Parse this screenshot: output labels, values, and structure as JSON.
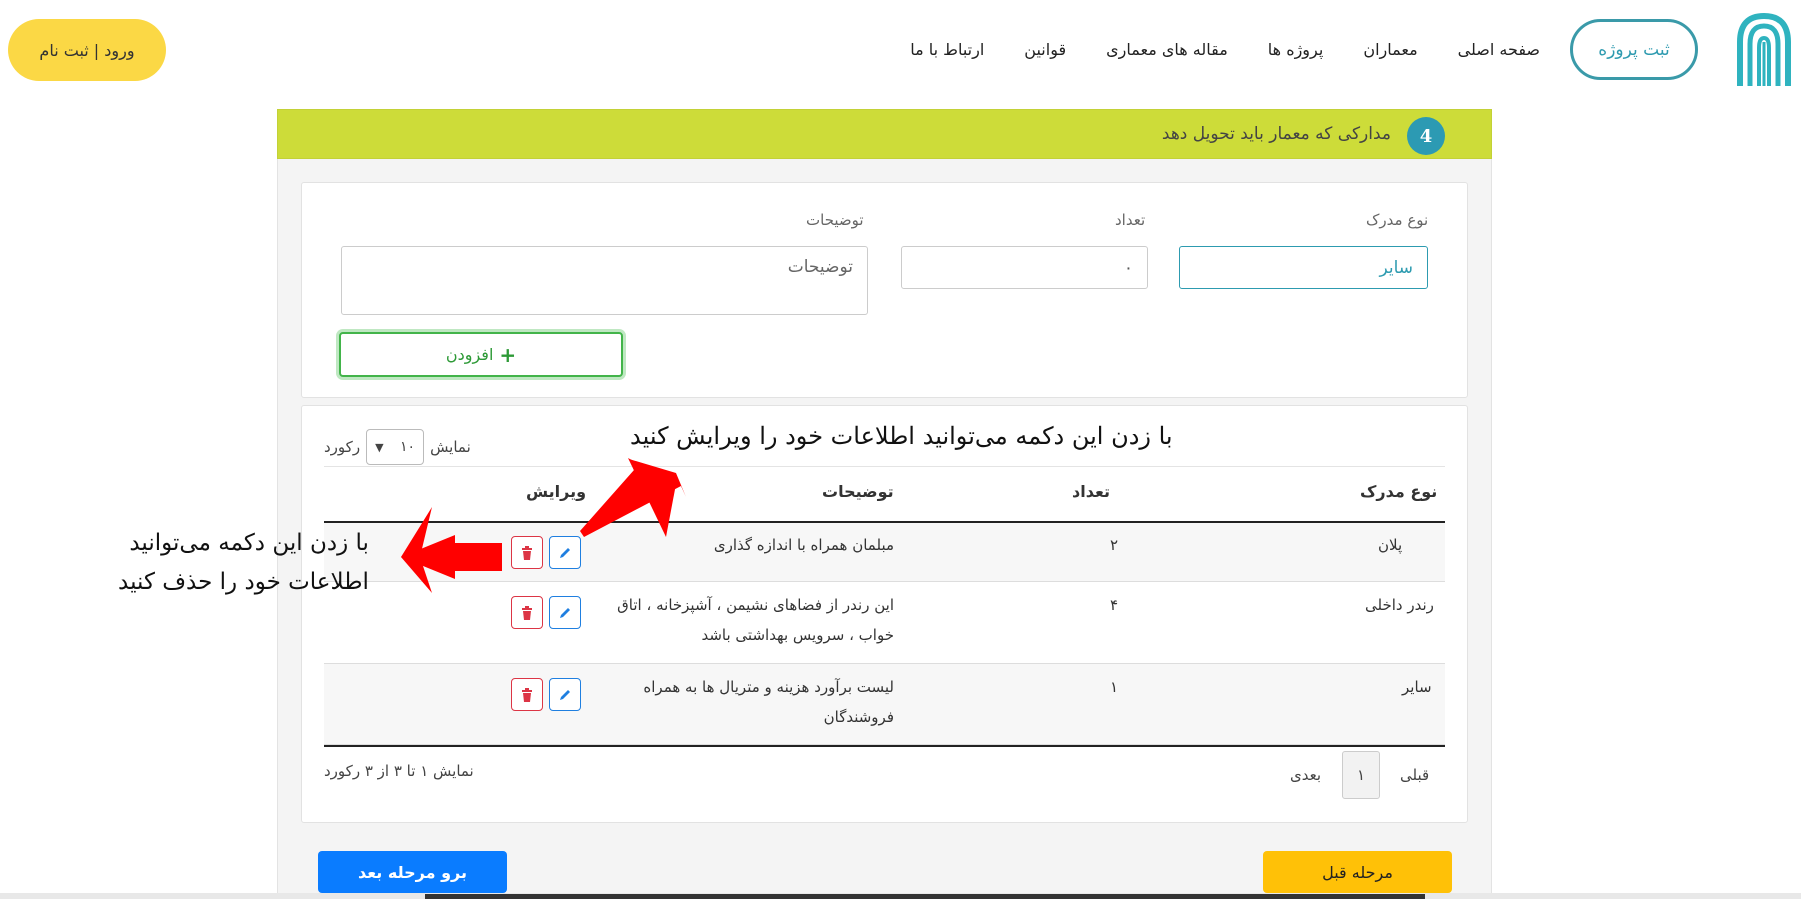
{
  "header": {
    "register_project": "ثبت پروژه",
    "login_register": "ورود | ثبت نام",
    "nav": [
      "صفحه اصلی",
      "معماران",
      "پروژه ها",
      "مقاله های معماری",
      "قوانین",
      "ارتباط با ما"
    ]
  },
  "step": {
    "number": "4",
    "title": "مدارکی که معمار باید تحویل دهد"
  },
  "form": {
    "type_label": "نوع مدرک",
    "type_value": "سایر",
    "count_label": "تعداد",
    "count_value": "۰",
    "desc_label": "توضیحات",
    "desc_placeholder": "توضیحات",
    "add_button": "افزودن"
  },
  "table": {
    "length_show": "نمایش",
    "length_value": "۱۰",
    "length_records": "رکورد",
    "headers": {
      "type": "نوع مدرک",
      "count": "تعداد",
      "desc": "توضیحات",
      "edit": "ویرایش"
    },
    "rows": [
      {
        "type": "پلان",
        "count": "۲",
        "desc": "مبلمان همراه با اندازه گذاری"
      },
      {
        "type": "رندر داخلی",
        "count": "۴",
        "desc": "این رندر از فضاهای نشیمن ، آشپزخانه ، اتاق خواب ، سرویس بهداشتی باشد"
      },
      {
        "type": "سایر",
        "count": "۱",
        "desc": "لیست برآورد هزینه و متریال ها به همراه فروشندگان"
      }
    ],
    "info": "نمایش ۱ تا ۳ از ۳ رکورد",
    "prev": "قبلی",
    "page": "۱",
    "next": "بعدی"
  },
  "buttons": {
    "next_step": "برو مرحله بعد",
    "prev_step": "مرحله قبل"
  },
  "annotations": {
    "edit_hint": "با زدن این دکمه می‌توانید اطلاعات خود را ویرایش کنید",
    "delete_hint_line1": "با زدن این دکمه می‌توانید",
    "delete_hint_line2": "اطلاعات خود را حذف کنید"
  },
  "colors": {
    "step_bar": "#cddc39",
    "step_badge": "#2c9ab3",
    "teal": "#2f9bb0",
    "login_yellow": "#fbd845",
    "add_green": "#42b44a",
    "edit_blue": "#1f7fe0",
    "delete_red": "#dc3545",
    "next_blue": "#0a7cff",
    "prev_yellow": "#ffc107",
    "arrow_red": "#ff0000"
  },
  "icons": [
    "logo-arch-icon",
    "plus-icon",
    "chevron-down-icon",
    "pencil-icon",
    "trash-icon"
  ]
}
